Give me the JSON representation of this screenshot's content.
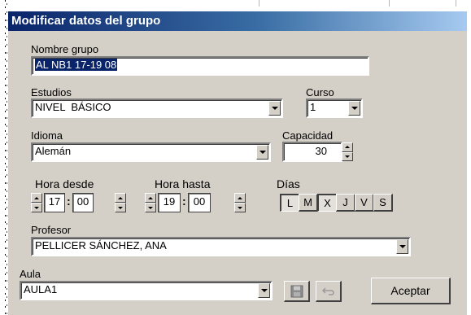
{
  "window": {
    "title": "Modificar datos del grupo"
  },
  "nombre_grupo": {
    "label": "Nombre grupo",
    "value": "AL NB1 17-19 08"
  },
  "estudios": {
    "label": "Estudios",
    "value": "NIVEL  BÁSICO"
  },
  "curso": {
    "label": "Curso",
    "value": "1"
  },
  "idioma": {
    "label": "Idioma",
    "value": "Alemán"
  },
  "capacidad": {
    "label": "Capacidad",
    "value": "30"
  },
  "hora_desde": {
    "label": "Hora desde",
    "hour": "17",
    "minute": "00"
  },
  "hora_hasta": {
    "label": "Hora hasta",
    "hour": "19",
    "minute": "00"
  },
  "dias": {
    "label": "Días",
    "items": [
      "L",
      "M",
      "X",
      "J",
      "V",
      "S"
    ],
    "selected": [
      "L",
      "X"
    ]
  },
  "profesor": {
    "label": "Profesor",
    "value": "PELLICER SÁNCHEZ, ANA"
  },
  "aula": {
    "label": "Aula",
    "value": "AULA1"
  },
  "buttons": {
    "save_icon": "floppy-disk-icon",
    "undo_icon": "undo-arrow-icon",
    "aceptar": "Aceptar"
  },
  "colors": {
    "titlebar_start": "#0a246a",
    "titlebar_end": "#a6caf0",
    "face": "#d4d0c8",
    "selection": "#0a246a"
  }
}
